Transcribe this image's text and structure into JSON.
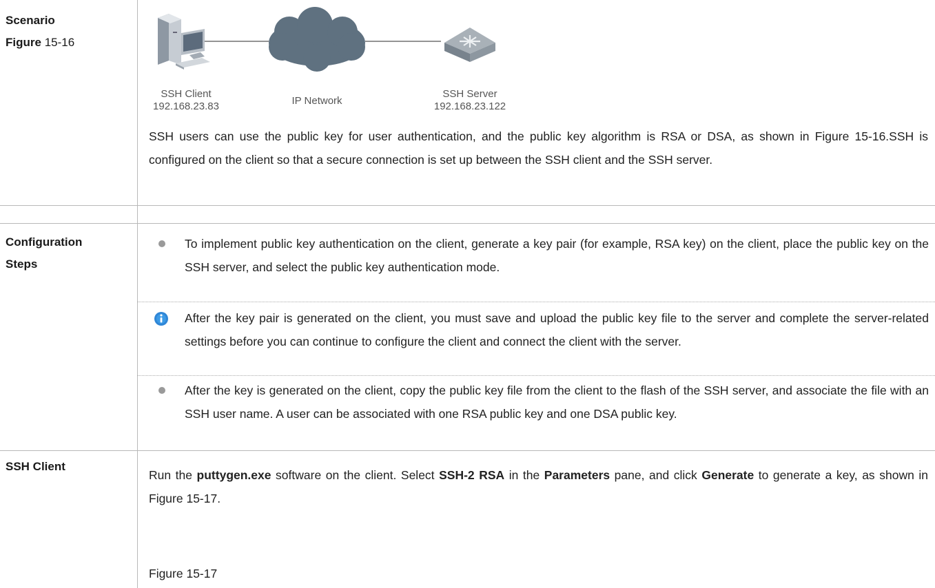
{
  "scenario": {
    "label": "Scenario",
    "figure_word": "Figure",
    "figure_num": "15-16",
    "diagram": {
      "client_name": "SSH Client",
      "client_ip": "192.168.23.83",
      "network_name": "IP Network",
      "server_name": "SSH Server",
      "server_ip": "192.168.23.122"
    },
    "description": "SSH users can use the public key for user authentication, and the public key algorithm is RSA or DSA, as shown in Figure 15-16.SSH is configured on the client so that a secure connection is set up between the SSH client and the SSH server."
  },
  "config": {
    "label_line1": "Configuration",
    "label_line2": "Steps",
    "step1": "To implement public key authentication on the client, generate a key pair (for example, RSA key) on the client, place the public key on the SSH server, and select the public key authentication mode.",
    "note": "After the key pair is generated on the client, you must save and upload the public key file to the server and complete the server-related settings before you can continue to configure the client and connect the client with the server.",
    "step2": "After the key is generated on the client, copy the public key file from the client to the flash of the SSH server, and associate the file with an SSH user name. A user can be associated with one RSA public key and one DSA public key."
  },
  "ssh_client": {
    "label": "SSH Client",
    "p1_a": "Run the ",
    "p1_b": "puttygen.exe",
    "p1_c": " software on the client. Select ",
    "p1_d": "SSH-2 RSA",
    "p1_e": " in the ",
    "p1_f": "Parameters",
    "p1_g": " pane, and click ",
    "p1_h": "Generate",
    "p1_i": " to generate a key, as shown in Figure 15-17.",
    "figure_caption": "Figure 15-17"
  }
}
